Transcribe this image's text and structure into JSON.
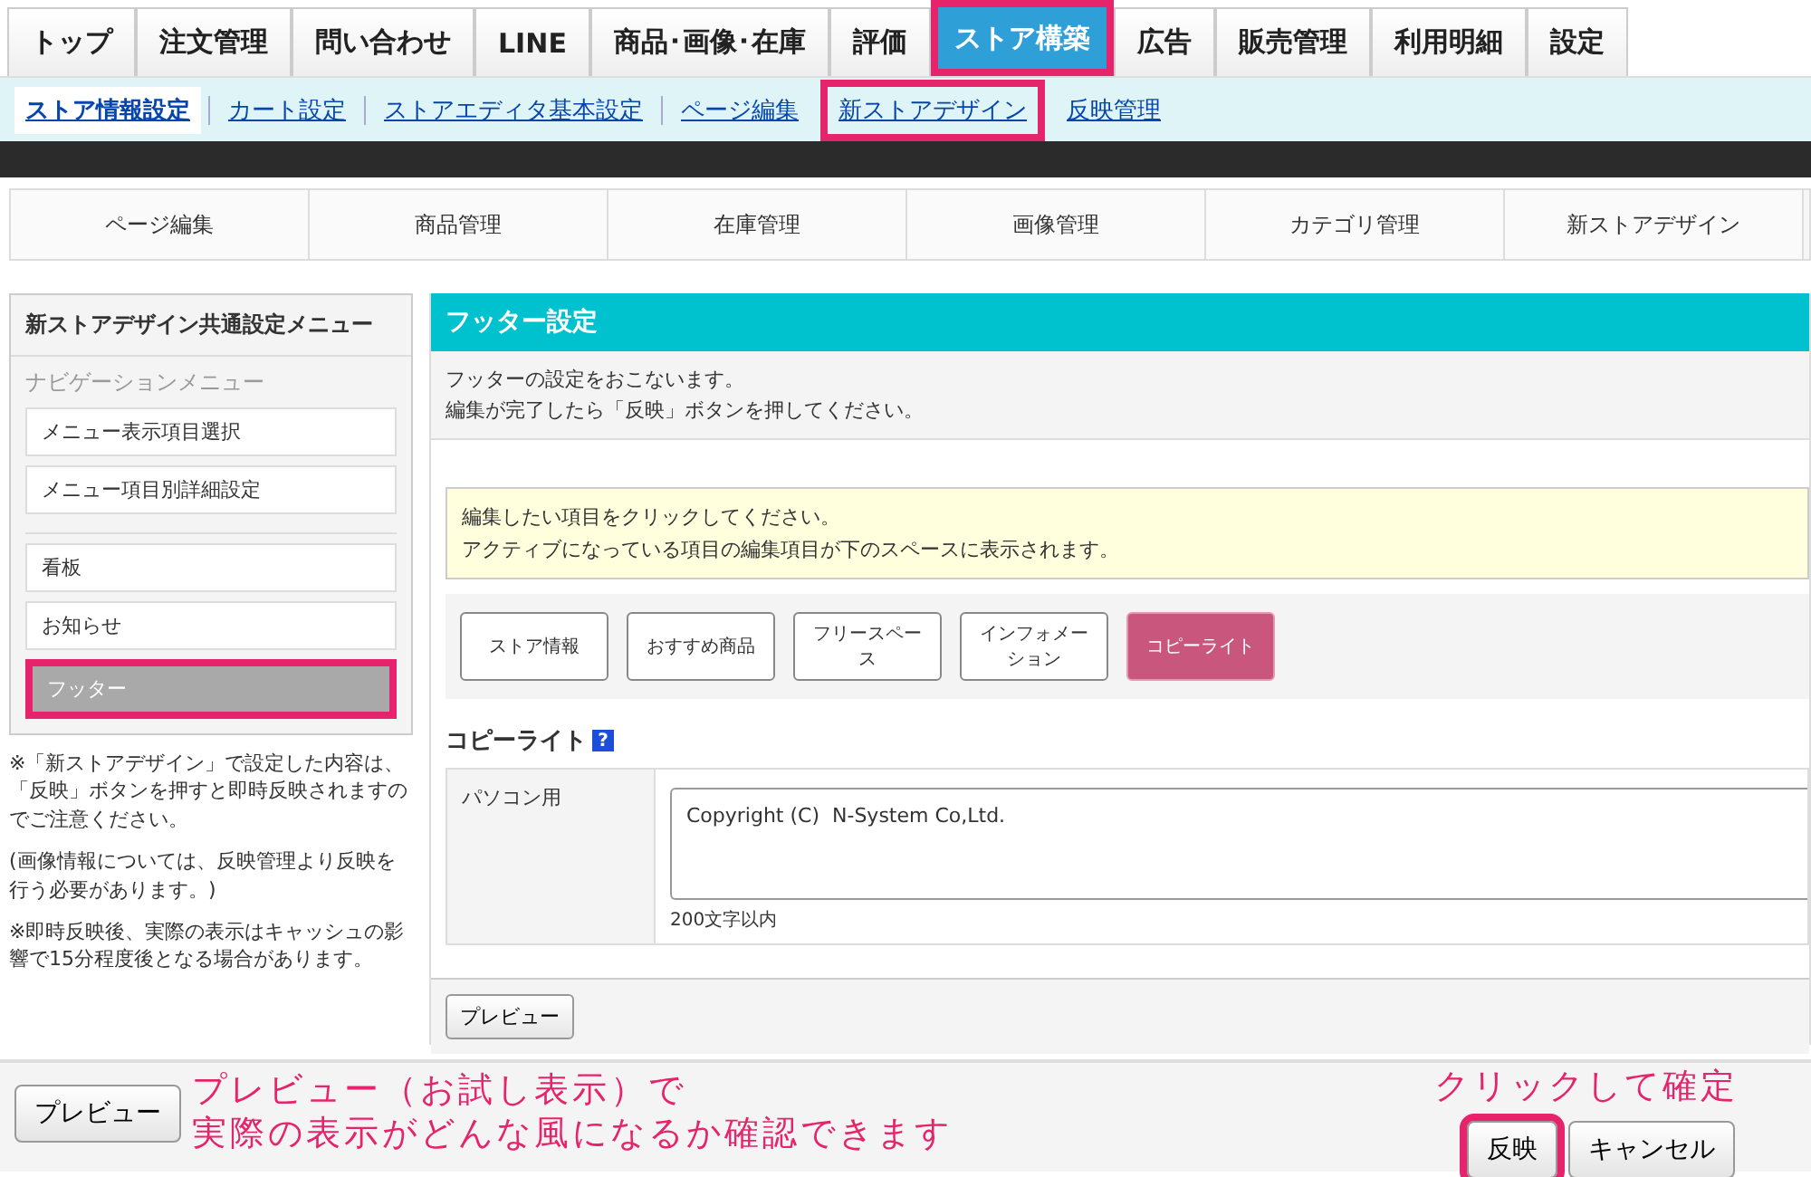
{
  "top_tabs": [
    {
      "label": "トップ",
      "selected": false,
      "highlighted": false
    },
    {
      "label": "注文管理",
      "selected": false,
      "highlighted": false
    },
    {
      "label": "問い合わせ",
      "selected": false,
      "highlighted": false
    },
    {
      "label": "LINE",
      "selected": false,
      "highlighted": false
    },
    {
      "label": "商品･画像･在庫",
      "selected": false,
      "highlighted": false
    },
    {
      "label": "評価",
      "selected": false,
      "highlighted": false
    },
    {
      "label": "ストア構築",
      "selected": true,
      "highlighted": true
    },
    {
      "label": "広告",
      "selected": false,
      "highlighted": false
    },
    {
      "label": "販売管理",
      "selected": false,
      "highlighted": false
    },
    {
      "label": "利用明細",
      "selected": false,
      "highlighted": false
    },
    {
      "label": "設定",
      "selected": false,
      "highlighted": false
    }
  ],
  "sub_nav": [
    {
      "label": "ストア情報設定",
      "selected": true,
      "highlighted": false
    },
    {
      "label": "カート設定",
      "selected": false,
      "highlighted": false
    },
    {
      "label": "ストアエディタ基本設定",
      "selected": false,
      "highlighted": false
    },
    {
      "label": "ページ編集",
      "selected": false,
      "highlighted": false
    },
    {
      "label": "新ストアデザイン",
      "selected": false,
      "highlighted": true
    },
    {
      "label": "反映管理",
      "selected": false,
      "highlighted": false
    }
  ],
  "section_tabs": [
    "ページ編集",
    "商品管理",
    "在庫管理",
    "画像管理",
    "カテゴリ管理",
    "新ストアデザイン"
  ],
  "sidebar": {
    "title": "新ストアデザイン共通設定メニュー",
    "group_label": "ナビゲーションメニュー",
    "groups": [
      {
        "items": [
          {
            "label": "メニュー表示項目選択",
            "selected": false,
            "highlighted": false
          },
          {
            "label": "メニュー項目別詳細設定",
            "selected": false,
            "highlighted": false
          }
        ]
      },
      {
        "items": [
          {
            "label": "看板",
            "selected": false,
            "highlighted": false
          },
          {
            "label": "お知らせ",
            "selected": false,
            "highlighted": false
          },
          {
            "label": "フッター",
            "selected": true,
            "highlighted": true
          }
        ]
      }
    ],
    "notes": [
      "※「新ストアデザイン」で設定した内容は、「反映」ボタンを押すと即時反映されますのでご注意ください。",
      "(画像情報については、反映管理より反映を行う必要があります。)",
      "※即時反映後、実際の表示はキャッシュの影響で15分程度後となる場合があります。"
    ]
  },
  "panel": {
    "title": "フッター設定",
    "description": [
      "フッターの設定をおこないます。",
      "編集が完了したら「反映」ボタンを押してください。"
    ],
    "hint": [
      "編集したい項目をクリックしてください。",
      "アクティブになっている項目の編集項目が下のスペースに表示されます。"
    ],
    "item_buttons": [
      {
        "label": "ストア情報",
        "selected": false
      },
      {
        "label": "おすすめ商品",
        "selected": false
      },
      {
        "label": "フリースペース",
        "selected": false
      },
      {
        "label": "インフォメーション",
        "selected": false
      },
      {
        "label": "コピーライト",
        "selected": true
      }
    ],
    "field_section": {
      "title": "コピーライト",
      "help": "?",
      "rows": [
        {
          "label": "パソコン用",
          "value": "Copyright (C)  N-System Co,Ltd.",
          "note": "200文字以内"
        }
      ]
    },
    "preview_button": "プレビュー"
  },
  "footer": {
    "preview_button": "プレビュー",
    "buttons": [
      {
        "label": "反映",
        "highlighted": true
      },
      {
        "label": "キャンセル",
        "highlighted": false
      }
    ]
  },
  "annotations": [
    {
      "kind": "preview",
      "lines": [
        "プレビュー（お試し表示）で",
        "実際の表示がどんな風になるか確認できます"
      ]
    },
    {
      "kind": "confirm",
      "lines": [
        "クリックして確定"
      ]
    }
  ]
}
